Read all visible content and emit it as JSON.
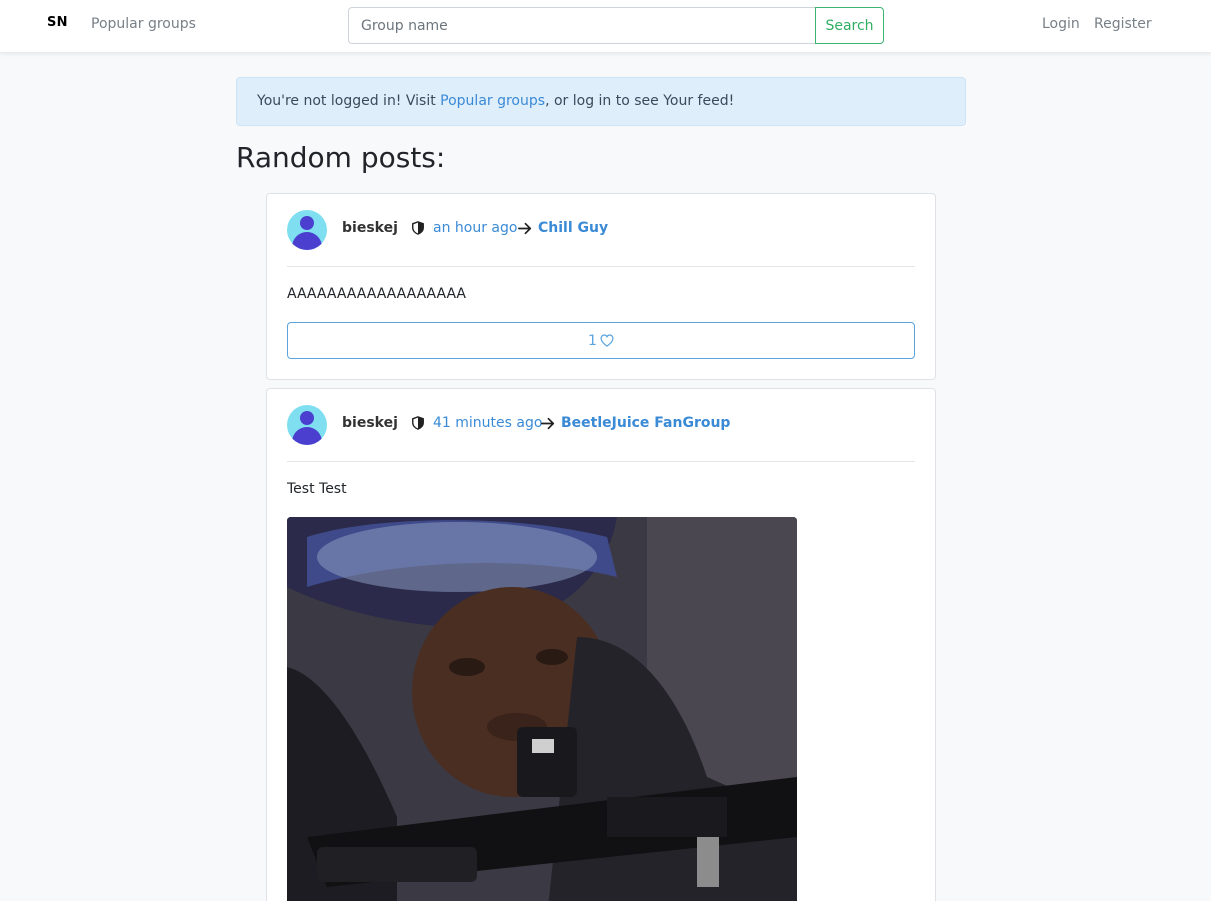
{
  "navbar": {
    "brand": "SN",
    "popular_groups": "Popular groups",
    "search_placeholder": "Group name",
    "search_button": "Search",
    "login": "Login",
    "register": "Register"
  },
  "alert": {
    "prefix": "You're not logged in! Visit ",
    "link": "Popular groups",
    "suffix": ", or log in to see Your feed!"
  },
  "page_title": "Random posts:",
  "posts": [
    {
      "author": "bieskej",
      "author_icon": "shield-icon",
      "time": "an hour ago",
      "group": "Chill Guy",
      "text": "AAAAAAAAAAAAAAAAAA",
      "likes": "1",
      "like_icon": "heart-icon"
    },
    {
      "author": "bieskej",
      "author_icon": "shield-icon",
      "time": "41 minutes ago",
      "group": "BeetleJuice FanGroup",
      "text": "Test Test",
      "image": "soldier-photo"
    }
  ],
  "colors": {
    "accent_blue": "#3a8ad6",
    "search_green": "#2fae63",
    "alert_bg": "#dfeefb",
    "avatar_bg": "#7fdff0",
    "avatar_fg": "#4b3fcf"
  }
}
